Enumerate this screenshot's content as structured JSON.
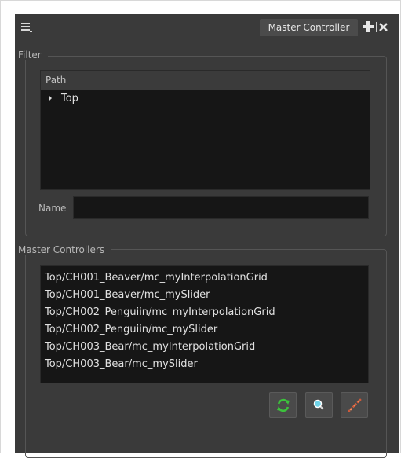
{
  "window": {
    "tab_label": "Master Controller"
  },
  "filter": {
    "title": "Filter",
    "tree_header": "Path",
    "tree_items": [
      {
        "label": "Top",
        "expanded": false
      }
    ],
    "name_label": "Name",
    "name_value": ""
  },
  "master_controllers": {
    "title": "Master Controllers",
    "items": [
      "Top/CH001_Beaver/mc_myInterpolationGrid",
      "Top/CH001_Beaver/mc_mySlider",
      "Top/CH002_Penguiin/mc_myInterpolationGrid",
      "Top/CH002_Penguiin/mc_mySlider",
      "Top/CH003_Bear/mc_myInterpolationGrid",
      "Top/CH003_Bear/mc_mySlider"
    ]
  },
  "toolbar": {
    "buttons": [
      {
        "icon": "refresh-icon"
      },
      {
        "icon": "select-icon"
      },
      {
        "icon": "show-controls-icon"
      }
    ]
  },
  "colors": {
    "panel_background": "#3a3a3a",
    "list_background": "#161616",
    "refresh_accent": "#3cc23c",
    "show_accent": "#d05a3a"
  }
}
